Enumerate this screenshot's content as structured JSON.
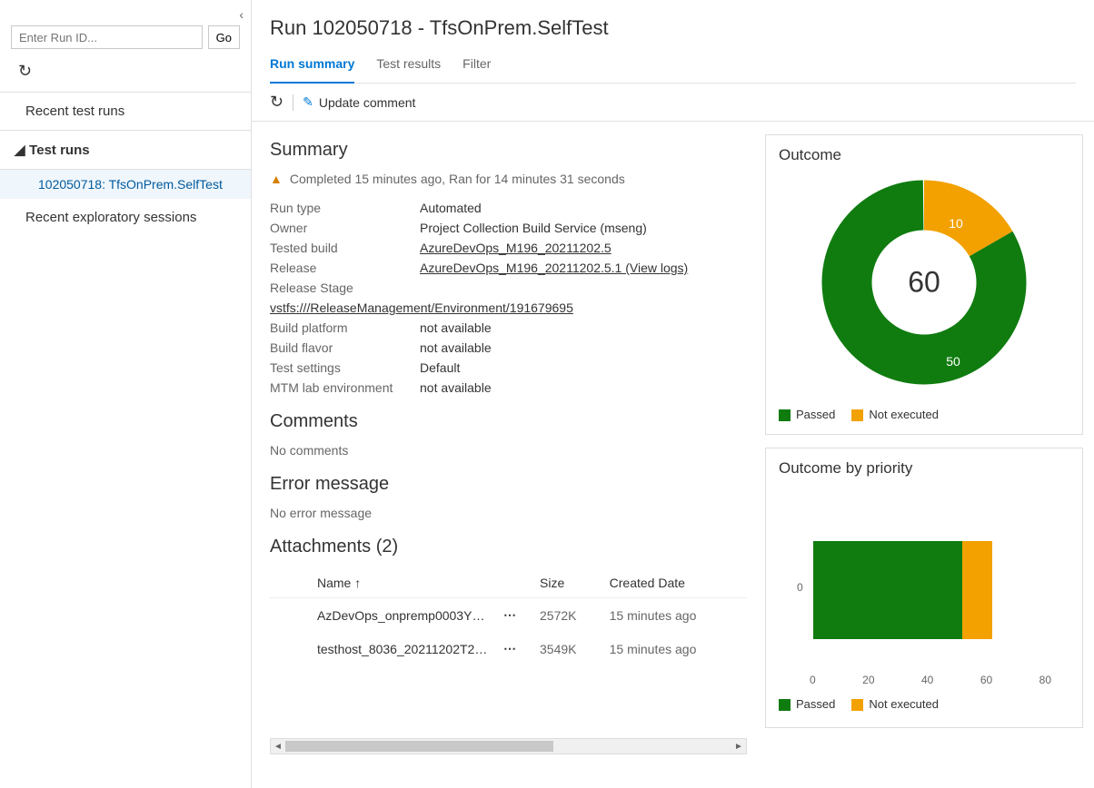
{
  "sidebar": {
    "search_placeholder": "Enter Run ID...",
    "go_label": "Go",
    "recent_runs_label": "Recent test runs",
    "test_runs_label": "Test runs",
    "run_item": "102050718: TfsOnPrem.SelfTest",
    "recent_sessions_label": "Recent exploratory sessions"
  },
  "header": {
    "title": "Run 102050718 - TfsOnPrem.SelfTest",
    "tabs": {
      "summary": "Run summary",
      "results": "Test results",
      "filter": "Filter"
    },
    "update_comment": "Update comment"
  },
  "summary": {
    "heading": "Summary",
    "status": "Completed 15 minutes ago, Ran for 14 minutes 31 seconds",
    "rows": {
      "run_type_k": "Run type",
      "run_type_v": "Automated",
      "owner_k": "Owner",
      "owner_v": "Project Collection Build Service (mseng)",
      "tested_build_k": "Tested build",
      "tested_build_v": "AzureDevOps_M196_20211202.5",
      "release_k": "Release",
      "release_v": "AzureDevOps_M196_20211202.5.1 (View logs)",
      "release_stage_k": "Release Stage",
      "release_stage_link": "vstfs:///ReleaseManagement/Environment/191679695",
      "build_platform_k": "Build platform",
      "build_platform_v": "not available",
      "build_flavor_k": "Build flavor",
      "build_flavor_v": "not available",
      "test_settings_k": "Test settings",
      "test_settings_v": "Default",
      "mtm_k": "MTM lab environment",
      "mtm_v": "not available"
    },
    "comments_heading": "Comments",
    "comments_body": "No comments",
    "error_heading": "Error message",
    "error_body": "No error message"
  },
  "attachments": {
    "heading": "Attachments (2)",
    "cols": {
      "name": "Name ↑",
      "size": "Size",
      "created": "Created Date"
    },
    "rows": [
      {
        "name": "AzDevOps_onpremp0003YO…",
        "size": "2572K",
        "created": "15 minutes ago"
      },
      {
        "name": "testhost_8036_20211202T20…",
        "size": "3549K",
        "created": "15 minutes ago"
      }
    ]
  },
  "outcome": {
    "title": "Outcome",
    "total": "60",
    "passed_label": "Passed",
    "notexec_label": "Not executed",
    "passed_count": "50",
    "notexec_count": "10"
  },
  "priority": {
    "title": "Outcome by priority",
    "y_label": "0",
    "x_ticks": [
      "0",
      "20",
      "40",
      "60",
      "80"
    ],
    "passed_label": "Passed",
    "notexec_label": "Not executed"
  },
  "colors": {
    "green": "#107c10",
    "orange": "#f2a100",
    "blue": "#0078d4"
  },
  "chart_data": [
    {
      "type": "pie",
      "title": "Outcome",
      "total": 60,
      "series": [
        {
          "name": "Passed",
          "value": 50,
          "color": "#107c10"
        },
        {
          "name": "Not executed",
          "value": 10,
          "color": "#f2a100"
        }
      ]
    },
    {
      "type": "bar",
      "orientation": "horizontal",
      "stacked": true,
      "title": "Outcome by priority",
      "xlabel": "",
      "ylabel": "",
      "xlim": [
        0,
        80
      ],
      "categories": [
        "0"
      ],
      "series": [
        {
          "name": "Passed",
          "values": [
            50
          ],
          "color": "#107c10"
        },
        {
          "name": "Not executed",
          "values": [
            10
          ],
          "color": "#f2a100"
        }
      ]
    }
  ]
}
